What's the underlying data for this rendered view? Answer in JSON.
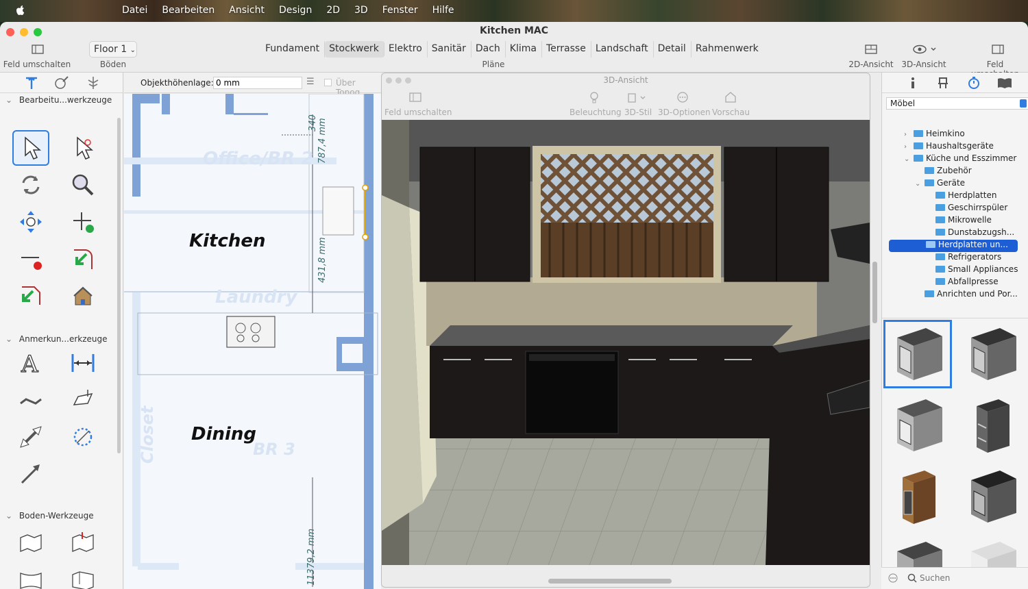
{
  "menubar": {
    "items": [
      "Datei",
      "Bearbeiten",
      "Ansicht",
      "Design",
      "2D",
      "3D",
      "Fenster",
      "Hilfe"
    ]
  },
  "window": {
    "title": "Kitchen MAC"
  },
  "toolbar": {
    "toggle_left": "Feld umschalten",
    "floor_select": "Floor 1",
    "floors_label": "Böden",
    "plans_label": "Pläne",
    "plan_tabs": [
      "Fundament",
      "Stockwerk",
      "Elektro",
      "Sanitär",
      "Dach",
      "Klima",
      "Terrasse",
      "Landschaft",
      "Detail",
      "Rahmenwerk"
    ],
    "selected_tab": "Stockwerk",
    "view2d": "2D-Ansicht",
    "view3d": "3D-Ansicht",
    "toggle_right": "Feld umschalten"
  },
  "leftpanel": {
    "sections": [
      "Bearbeitu...werkzeuge",
      "Anmerkun...erkzeuge",
      "Boden-Werkzeuge"
    ]
  },
  "plan": {
    "height_label": "Objekthöhenlage:",
    "height_value": "0 mm",
    "topo_label": "Über Topog",
    "rooms": [
      "Office/BR 2",
      "Kitchen",
      "Laundry",
      "Dining",
      "BR 3",
      "Closet"
    ],
    "dimensions": [
      "340",
      "787,4 mm",
      "431,8 mm",
      "11379,2 mm"
    ]
  },
  "view3d": {
    "title": "3D-Ansicht",
    "toggle": "Feld umschalten",
    "buttons": [
      "Beleuchtung",
      "3D-Stil",
      "3D-Optionen",
      "Vorschau"
    ]
  },
  "rightpanel": {
    "category": "Möbel",
    "tree": [
      {
        "label": "Heimkino",
        "level": 1,
        "chev": ">"
      },
      {
        "label": "Haushaltsgeräte",
        "level": 1,
        "chev": ">"
      },
      {
        "label": "Küche und Esszimmer",
        "level": 1,
        "chev": "v"
      },
      {
        "label": "Zubehör",
        "level": 2,
        "chev": ""
      },
      {
        "label": "Geräte",
        "level": 2,
        "chev": "v"
      },
      {
        "label": "Herdplatten",
        "level": 3,
        "chev": ""
      },
      {
        "label": "Geschirrspüler",
        "level": 3,
        "chev": ""
      },
      {
        "label": "Mikrowelle",
        "level": 3,
        "chev": ""
      },
      {
        "label": "Dunstabzugsh...",
        "level": 3,
        "chev": ""
      },
      {
        "label": "Herdplatten un...",
        "level": 3,
        "chev": "",
        "selected": true
      },
      {
        "label": "Refrigerators",
        "level": 3,
        "chev": ""
      },
      {
        "label": "Small Appliances",
        "level": 3,
        "chev": ""
      },
      {
        "label": "Abfallpresse",
        "level": 3,
        "chev": ""
      },
      {
        "label": "Anrichten und Por...",
        "level": 2,
        "chev": ""
      }
    ],
    "search_placeholder": "Suchen"
  }
}
